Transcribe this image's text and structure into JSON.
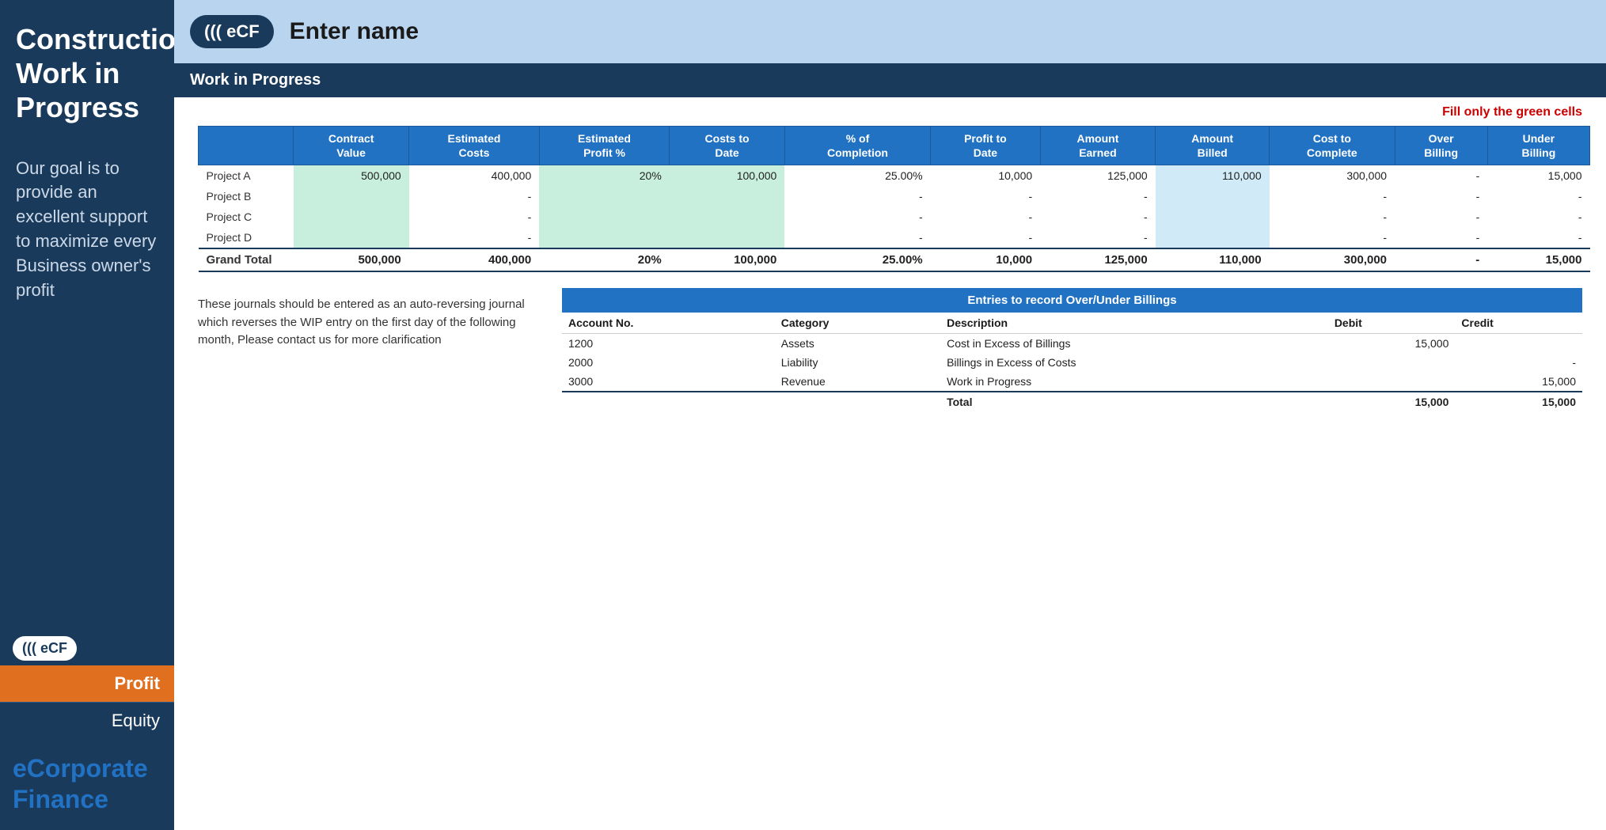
{
  "sidebar": {
    "title": "Construction Work in Progress",
    "tagline": "Our goal is to provide an excellent support to maximize every Business owner's profit",
    "ecf_label": "((( eCF",
    "btn_profit": "Profit",
    "btn_equity": "Equity",
    "brand": "eCorporate Finance"
  },
  "header": {
    "ecf_badge": "((( eCF",
    "title": "Enter name",
    "subtitle": "Work in Progress"
  },
  "fill_notice": "Fill only the green cells",
  "table": {
    "columns": [
      "Contract\nValue",
      "Estimated\nCosts",
      "Estimated\nProfit %",
      "Costs to\nDate",
      "% of\nCompletion",
      "Profit to\nDate",
      "Amount\nEarned",
      "Amount\nBilled",
      "Cost to\nComplete",
      "Over\nBilling",
      "Under\nBilling"
    ],
    "rows": [
      {
        "label": "Project A",
        "contract_value": "500,000",
        "est_costs": "400,000",
        "est_profit_pct": "20%",
        "costs_to_date": "100,000",
        "pct_completion": "25.00%",
        "profit_to_date": "10,000",
        "amount_earned": "125,000",
        "amount_billed": "110,000",
        "cost_to_complete": "300,000",
        "over_billing": "-",
        "under_billing": "15,000"
      },
      {
        "label": "Project B",
        "contract_value": "",
        "est_costs": "-",
        "est_profit_pct": "",
        "costs_to_date": "",
        "pct_completion": "-",
        "profit_to_date": "-",
        "amount_earned": "-",
        "amount_billed": "",
        "cost_to_complete": "-",
        "over_billing": "-",
        "under_billing": "-"
      },
      {
        "label": "Project C",
        "contract_value": "",
        "est_costs": "-",
        "est_profit_pct": "",
        "costs_to_date": "",
        "pct_completion": "-",
        "profit_to_date": "-",
        "amount_earned": "-",
        "amount_billed": "",
        "cost_to_complete": "-",
        "over_billing": "-",
        "under_billing": "-"
      },
      {
        "label": "Project D",
        "contract_value": "",
        "est_costs": "-",
        "est_profit_pct": "",
        "costs_to_date": "",
        "pct_completion": "-",
        "profit_to_date": "-",
        "amount_earned": "-",
        "amount_billed": "",
        "cost_to_complete": "-",
        "over_billing": "-",
        "under_billing": "-"
      }
    ],
    "grand_total": {
      "label": "Grand Total",
      "contract_value": "500,000",
      "est_costs": "400,000",
      "est_profit_pct": "20%",
      "costs_to_date": "100,000",
      "pct_completion": "25.00%",
      "profit_to_date": "10,000",
      "amount_earned": "125,000",
      "amount_billed": "110,000",
      "cost_to_complete": "300,000",
      "over_billing": "-",
      "under_billing": "15,000"
    }
  },
  "bottom_note": "These journals should be entered as an auto-reversing journal which reverses the WIP entry on the first day of the following month, Please contact us for more clarification",
  "entries": {
    "title": "Entries to record Over/Under Billings",
    "columns": [
      "Account No.",
      "Category",
      "Description",
      "Debit",
      "Credit"
    ],
    "rows": [
      {
        "account_no": "1200",
        "category": "Assets",
        "description": "Cost in Excess of Billings",
        "debit": "15,000",
        "credit": ""
      },
      {
        "account_no": "2000",
        "category": "Liability",
        "description": "Billings in Excess of Costs",
        "debit": "",
        "credit": "-"
      },
      {
        "account_no": "3000",
        "category": "Revenue",
        "description": "Work in Progress",
        "debit": "",
        "credit": "15,000"
      }
    ],
    "total_row": {
      "label": "Total",
      "debit": "15,000",
      "credit": "15,000"
    }
  }
}
